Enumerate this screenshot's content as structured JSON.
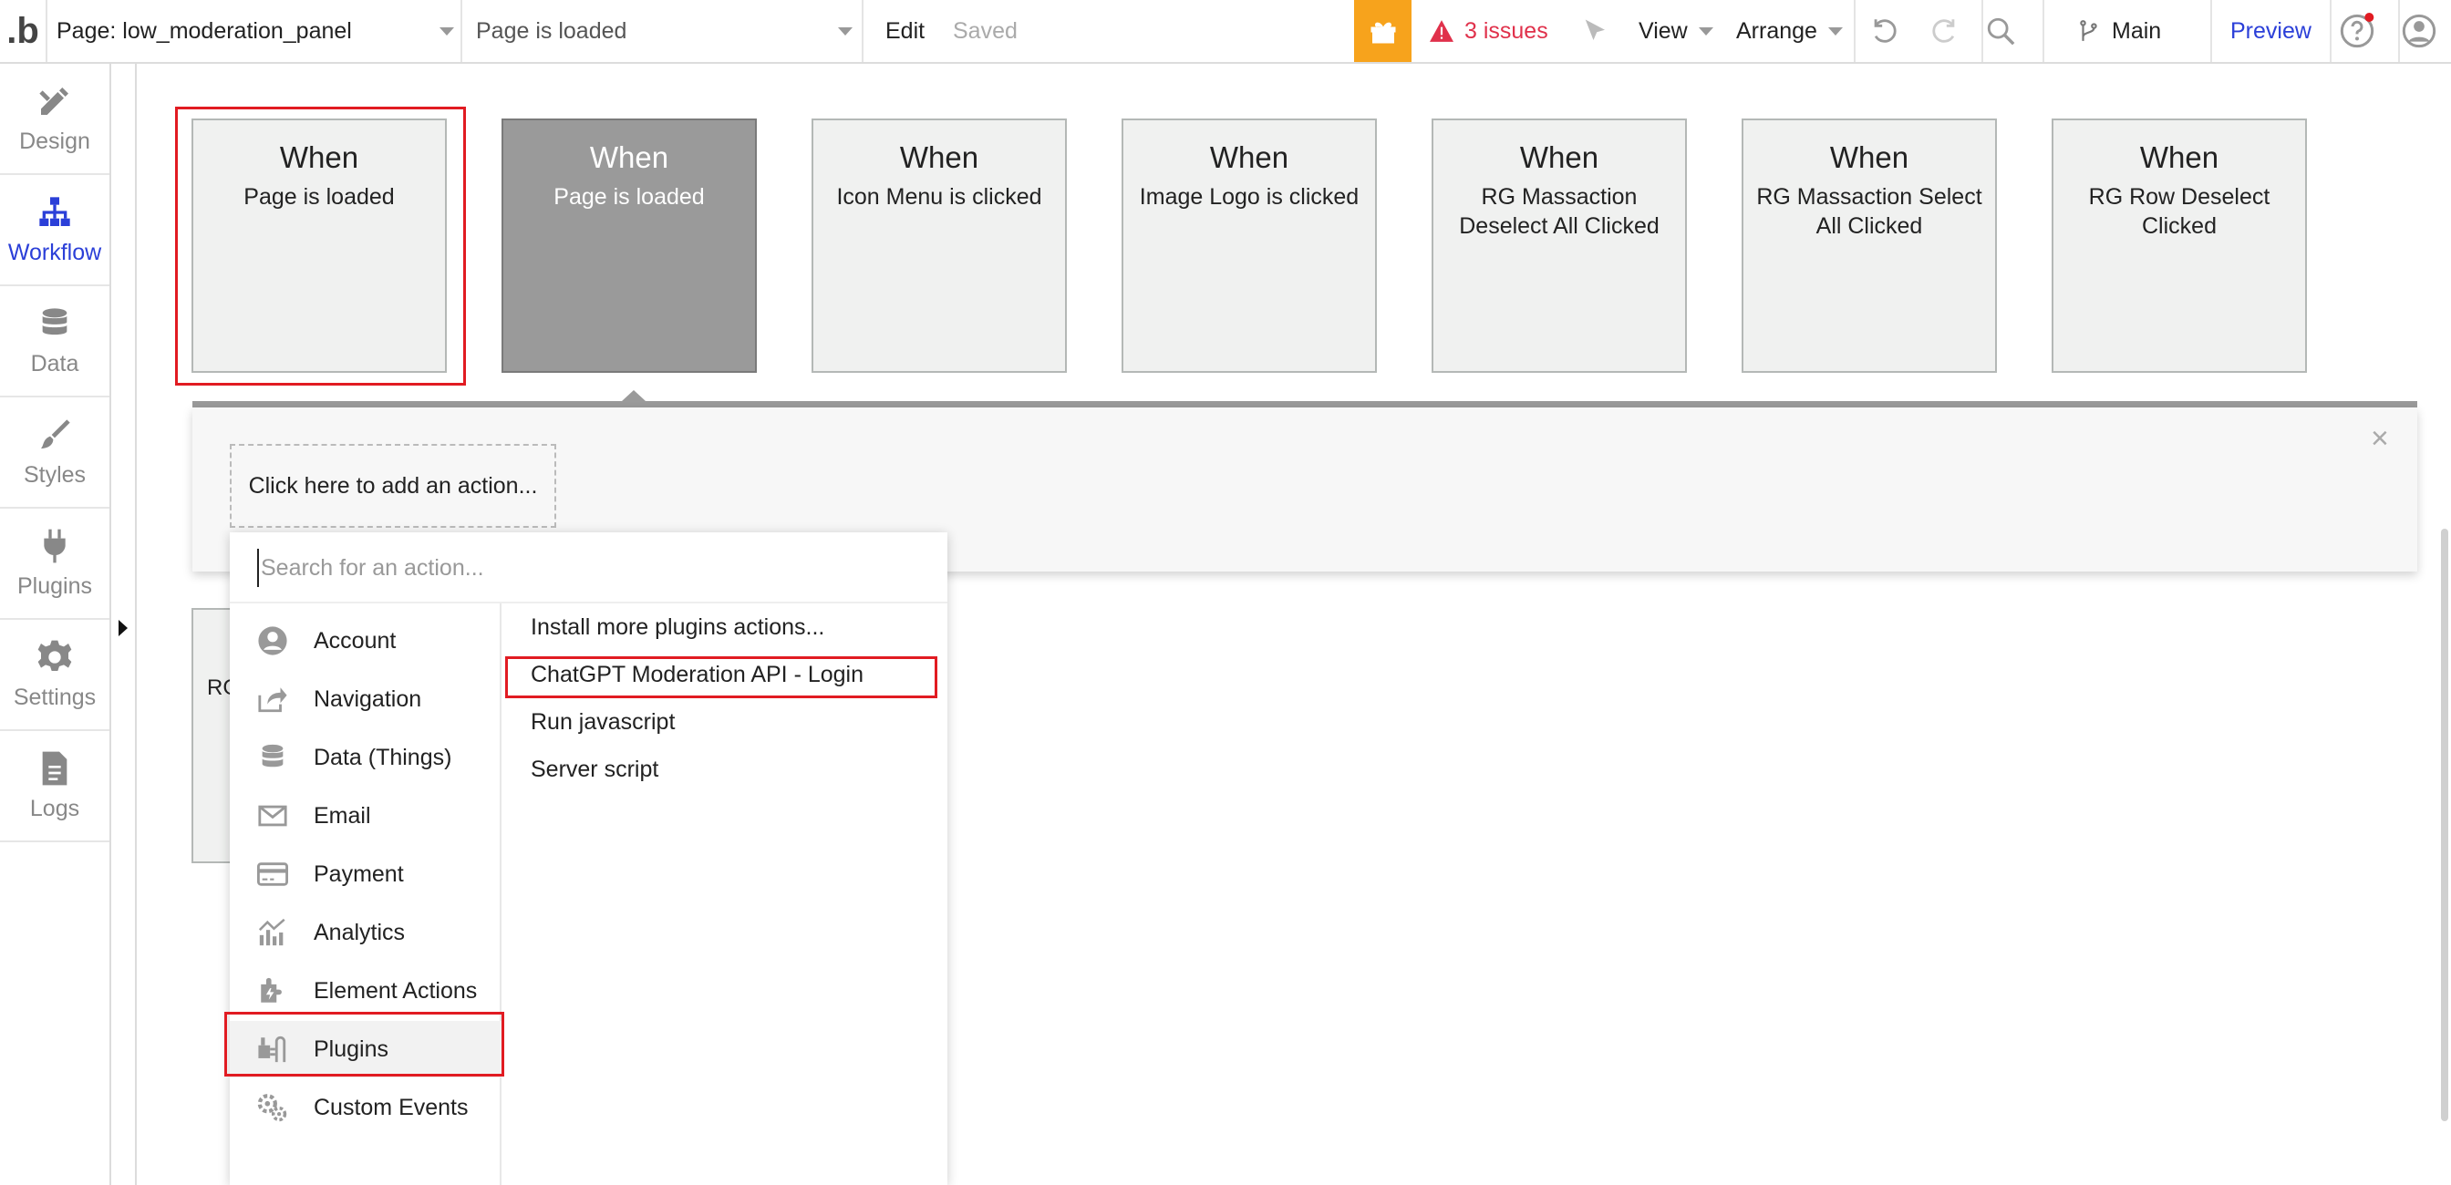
{
  "topbar": {
    "logo": ".b",
    "page_selector": "Page: low_moderation_panel",
    "event_selector": "Page is loaded",
    "edit_label": "Edit",
    "status": "Saved",
    "issues": "3 issues",
    "view_label": "View",
    "arrange_label": "Arrange",
    "branch": "Main",
    "preview_label": "Preview"
  },
  "sidebar": {
    "items": [
      {
        "label": "Design",
        "icon": "pencil-ruler-icon"
      },
      {
        "label": "Workflow",
        "icon": "workflow-icon"
      },
      {
        "label": "Data",
        "icon": "database-icon"
      },
      {
        "label": "Styles",
        "icon": "brush-icon"
      },
      {
        "label": "Plugins",
        "icon": "plug-icon"
      },
      {
        "label": "Settings",
        "icon": "gear-icon"
      },
      {
        "label": "Logs",
        "icon": "document-icon"
      }
    ]
  },
  "events": [
    {
      "when": "When",
      "trigger": "Page is loaded"
    },
    {
      "when": "When",
      "trigger": "Page is loaded"
    },
    {
      "when": "When",
      "trigger": "Icon Menu is clicked"
    },
    {
      "when": "When",
      "trigger": "Image Logo is clicked"
    },
    {
      "when": "When",
      "trigger": "RG Massaction Deselect All Clicked"
    },
    {
      "when": "When",
      "trigger": "RG Massaction Select All Clicked"
    },
    {
      "when": "When",
      "trigger": "RG Row Deselect Clicked"
    }
  ],
  "action_panel": {
    "add_action": "Click here to add an action...",
    "close": "×"
  },
  "background_card_text": "RG",
  "dropdown": {
    "search_placeholder": "Search for an action...",
    "categories": [
      {
        "label": "Account",
        "icon": "account-icon"
      },
      {
        "label": "Navigation",
        "icon": "navigation-icon"
      },
      {
        "label": "Data (Things)",
        "icon": "database-icon"
      },
      {
        "label": "Email",
        "icon": "email-icon"
      },
      {
        "label": "Payment",
        "icon": "credit-card-icon"
      },
      {
        "label": "Analytics",
        "icon": "analytics-icon"
      },
      {
        "label": "Element Actions",
        "icon": "element-actions-icon"
      },
      {
        "label": "Plugins",
        "icon": "plugin-icon"
      },
      {
        "label": "Custom Events",
        "icon": "gears-icon"
      }
    ],
    "selected_category": "Plugins",
    "actions": [
      "Install more plugins actions...",
      "ChatGPT Moderation API - Login",
      "Run javascript",
      "Server script"
    ]
  },
  "colors": {
    "accent": "#2b3fd8",
    "highlight": "#e11b22",
    "issues": "#e0314b",
    "gift": "#f7a31c",
    "selected_card": "#9a9a9a"
  }
}
